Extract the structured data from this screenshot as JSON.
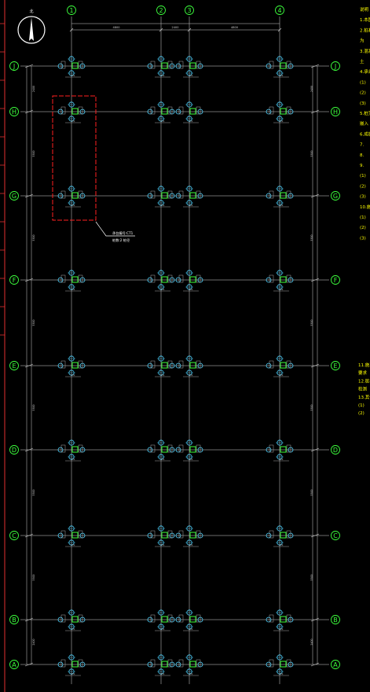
{
  "drawing": {
    "background": "#000000",
    "colors": {
      "axis": "#d8d8d8",
      "bubble": "#3cff3c",
      "pile": "#4fd3ff",
      "cap": "#3cff3c",
      "dim": "#cfcfcf",
      "highlight": "#ff2020",
      "notes": "#ffff00",
      "left_strip": "#e23030"
    },
    "north_arrow_label": "北",
    "top_axes": [
      "1",
      "2",
      "3",
      "4"
    ],
    "side_axes": [
      "J",
      "H",
      "G",
      "F",
      "E",
      "D",
      "C",
      "B",
      "A"
    ],
    "top_dims": [
      "4800",
      "2400",
      "4800"
    ],
    "left_dims": [
      "2400",
      "3300",
      "3300",
      "3300",
      "3300",
      "3300",
      "3300",
      "2400"
    ],
    "callout_text": [
      "承台编号:CT1",
      "桩数:2 桩径"
    ],
    "pile_tag": "CT1",
    "notes_lines": [
      "说明",
      "1.本图",
      "2.桩基",
      "  为",
      "3.混凝",
      "  土",
      "4.承台",
      "  (1)",
      "  (2)",
      "  (3)",
      "5.桩顶",
      "  嵌入",
      "6.成桩",
      "7.",
      "8.",
      "9.",
      "  (1)",
      "  (2)",
      "  (3)",
      "10.施工",
      "  (1)",
      "  (2)",
      "  (3)"
    ],
    "notes_lines_2": [
      "11.施工",
      "  要求",
      "12.桩基",
      "  检测",
      "13.其他",
      "  (1)",
      "  (2)"
    ]
  }
}
